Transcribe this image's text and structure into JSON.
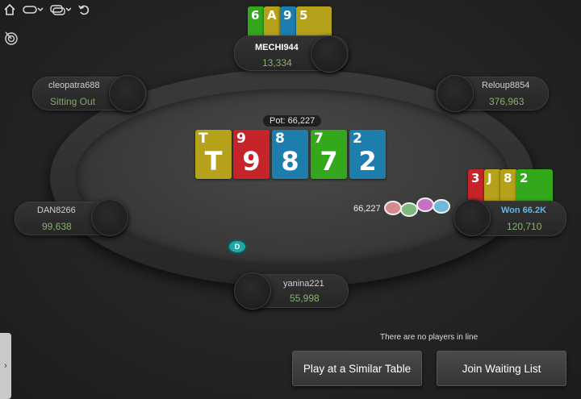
{
  "colors": {
    "spade": "#b5a21a",
    "heart": "#c7232b",
    "club": "#33a81c",
    "diamond": "#1d7eae",
    "stack": "#86b36b",
    "winner": "#5fb8e8"
  },
  "top_icons": [
    "home-icon",
    "sit-out-icon",
    "rebuy-icon",
    "undo-icon"
  ],
  "pot": {
    "label": "Pot: 66,227"
  },
  "board": [
    {
      "rank": "T",
      "suit": "spade"
    },
    {
      "rank": "9",
      "suit": "heart"
    },
    {
      "rank": "8",
      "suit": "diamond"
    },
    {
      "rank": "7",
      "suit": "club"
    },
    {
      "rank": "2",
      "suit": "diamond"
    }
  ],
  "players": {
    "top": {
      "name": "MECHI944",
      "stack": "13,334",
      "cards": [
        {
          "rank": "6",
          "suit": "club"
        },
        {
          "rank": "A",
          "suit": "spade"
        },
        {
          "rank": "9",
          "suit": "diamond"
        },
        {
          "rank": "5",
          "suit": "spade"
        }
      ]
    },
    "top_left": {
      "name": "cleopatra688",
      "stack": "Sitting Out"
    },
    "top_right": {
      "name": "Reloup8854",
      "stack": "376,963"
    },
    "left": {
      "name": "DAN8266",
      "stack": "99,638"
    },
    "right": {
      "name": "Won 66.2K",
      "stack": "120,710",
      "cards": [
        {
          "rank": "3",
          "suit": "heart"
        },
        {
          "rank": "J",
          "suit": "spade"
        },
        {
          "rank": "8",
          "suit": "spade"
        },
        {
          "rank": "2",
          "suit": "club"
        }
      ]
    },
    "bottom": {
      "name": "yanina221",
      "stack": "55,998"
    }
  },
  "winner_chips": {
    "amount": "66,227"
  },
  "dealer_button": "D",
  "queue_text": "There are no players in line",
  "buttons": {
    "similar": "Play at a Similar Table",
    "waitlist": "Join Waiting List"
  }
}
